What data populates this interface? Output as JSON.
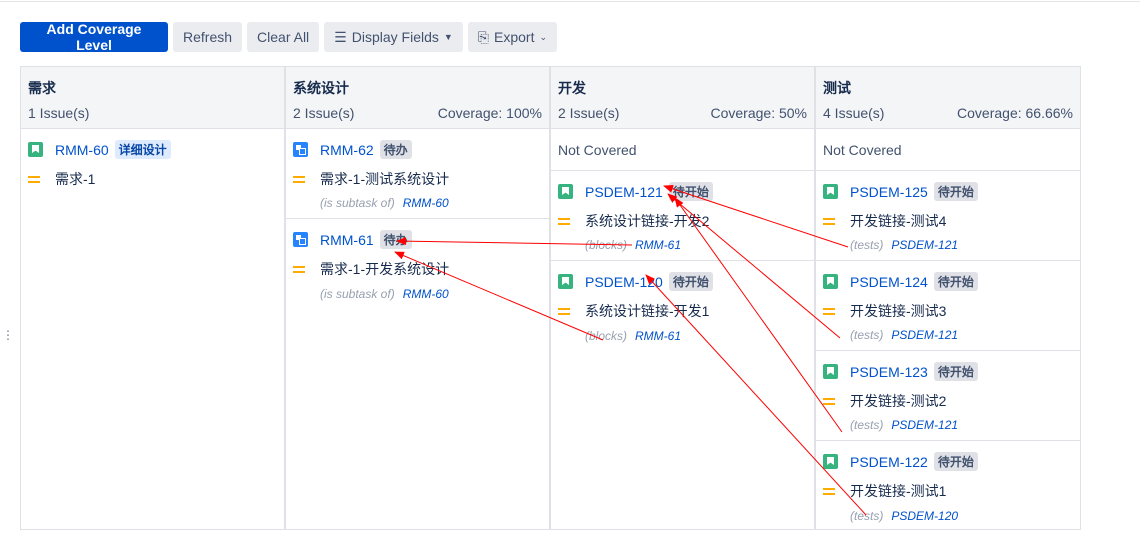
{
  "toolbar": {
    "add": "Add Coverage Level",
    "refresh": "Refresh",
    "clear": "Clear All",
    "display": "Display Fields",
    "export": "Export"
  },
  "columns": [
    {
      "title": "需求",
      "count": "1 Issue(s)",
      "coverage": ""
    },
    {
      "title": "系统设计",
      "count": "2 Issue(s)",
      "coverage": "Coverage: 100%"
    },
    {
      "title": "开发",
      "count": "2 Issue(s)",
      "coverage": "Coverage: 50%",
      "not_covered": "Not Covered"
    },
    {
      "title": "测试",
      "count": "4 Issue(s)",
      "coverage": "Coverage: 66.66%",
      "not_covered": "Not Covered"
    }
  ],
  "issues": {
    "rmm60": {
      "key": "RMM-60",
      "status": "详细设计",
      "summary": "需求-1"
    },
    "rmm62": {
      "key": "RMM-62",
      "status": "待办",
      "summary": "需求-1-测试系统设计",
      "rel": "(is subtask of)",
      "link": "RMM-60"
    },
    "rmm61": {
      "key": "RMM-61",
      "status": "待办",
      "summary": "需求-1-开发系统设计",
      "rel": "(is subtask of)",
      "link": "RMM-60"
    },
    "p121": {
      "key": "PSDEM-121",
      "status": "待开始",
      "summary": "系统设计链接-开发2",
      "rel": "(blocks)",
      "link": "RMM-61"
    },
    "p120": {
      "key": "PSDEM-120",
      "status": "待开始",
      "summary": "系统设计链接-开发1",
      "rel": "(blocks)",
      "link": "RMM-61"
    },
    "p125": {
      "key": "PSDEM-125",
      "status": "待开始",
      "summary": "开发链接-测试4",
      "rel": "(tests)",
      "link": "PSDEM-121"
    },
    "p124": {
      "key": "PSDEM-124",
      "status": "待开始",
      "summary": "开发链接-测试3",
      "rel": "(tests)",
      "link": "PSDEM-121"
    },
    "p123": {
      "key": "PSDEM-123",
      "status": "待开始",
      "summary": "开发链接-测试2",
      "rel": "(tests)",
      "link": "PSDEM-121"
    },
    "p122": {
      "key": "PSDEM-122",
      "status": "待开始",
      "summary": "开发链接-测试1",
      "rel": "(tests)",
      "link": "PSDEM-120"
    }
  },
  "colors": {
    "primary": "#0052cc",
    "story": "#36b37e",
    "subtask": "#2684ff",
    "priority": "#ffab00",
    "arrow": "#ff0000"
  }
}
